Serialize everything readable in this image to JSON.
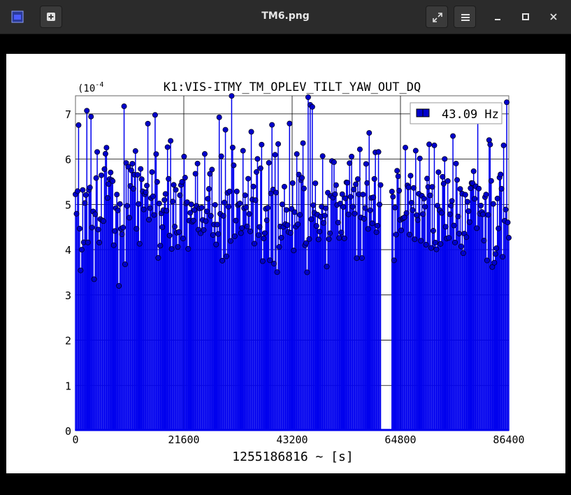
{
  "window": {
    "title": "TM6.png"
  },
  "icons": {
    "app": "image-icon",
    "new_tab": "new-tab-icon",
    "fullscreen": "fullscreen-icon",
    "menu": "hamburger-menu-icon",
    "minimize": "minimize-icon",
    "maximize": "maximize-icon",
    "close": "close-icon"
  },
  "colors": {
    "series": "#0000ee",
    "marker": "#0000cc",
    "titlebar": "#2b2b2b"
  },
  "chart_data": {
    "type": "stem",
    "title": "K1:VIS-ITMY_TM_OPLEV_TILT_YAW_OUT_DQ",
    "xlabel": "1255186816 ~ [s]",
    "ylabel": "",
    "multiplier_base": "(10",
    "multiplier_exp": "-4",
    "xlim": [
      0,
      86400
    ],
    "ylim": [
      0,
      7.4
    ],
    "xticks": [
      "0",
      "21600",
      "43200",
      "64800",
      "86400"
    ],
    "yticks": [
      "0",
      "1",
      "2",
      "3",
      "4",
      "5",
      "6",
      "7"
    ],
    "grid": true,
    "legend_position": "top-right",
    "series": [
      {
        "name": "43.09 Hz",
        "x_start": 0,
        "x_end": 86400,
        "count": 420,
        "y_min": 3.2,
        "y_max": 7.4,
        "y_typical": 4.9,
        "gap_start": 61000,
        "gap_end": 63000
      }
    ]
  }
}
